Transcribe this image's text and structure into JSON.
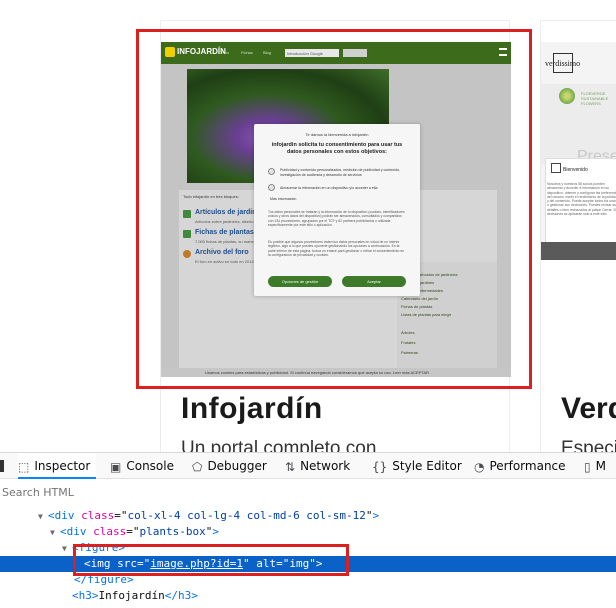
{
  "page": {
    "card1": {
      "title": "Infojardín",
      "desc": "Un portal completo con"
    },
    "card2": {
      "title": "Verd",
      "desc": "Especi"
    }
  },
  "infojardin_shot": {
    "logo": "INFOJARDÍN",
    "nav": [
      "Foro",
      "Fichas",
      "Blog"
    ],
    "search_placeholder": "Introducción Google",
    "heading": "Todo infojardín en tres bloques:",
    "links": [
      {
        "title": "Artículos de jardinería",
        "sub": "Artículos sobre jardinería, diseño..."
      },
      {
        "title": "Fichas de plantas",
        "sub": "7.000 fichas de plantas, su manejo..."
      },
      {
        "title": "Archivo del foro",
        "sub": "El foro en activo en todo en 2014..."
      }
    ],
    "sidebar": [
      "Césped",
      "Árboles y arbustos de jardinería",
      "Diseño de jardines",
      "Plagas y enfermedades",
      "Calendario del jardín",
      "Fichas de plantas",
      "Listas de plantas para elegir",
      "Árboles",
      "Frutales",
      "Palmeras"
    ],
    "footer": "Usamos cookies para estadísticas y publicidad. Si continúa navegando consideramos que acepta su uso.   Leer más      ACEPTAR",
    "modal": {
      "welcome": "Te damos la bienvenida a infojardín",
      "title": "infojardin solicita tu consentimiento para usar tus datos personales con estos objetivos:",
      "options": [
        "Publicidad y contenido personalizados, medición de publicidad y contenido, investigación de audiencia y desarrollo de servicios",
        "Almacenar la información en un dispositivo y/o acceder a ella"
      ],
      "more": "Más información",
      "body1": "Tus datos personales se tratarán y la información de tu dispositivo (cookies, identificadores únicos y otros datos del dispositivo) podrán ser almacenados, consultados y compartidos con 134 proveedores, agrupados por el TCF y 62 partners publicitarios o utilizada específicamente por este sitio o aplicación.",
      "body2": "Es posible que algunos proveedores traten tus datos personales en virtud de un interés legítimo, algo a lo que puedes oponerte gestionando tus opciones a continuación. En la parte inferior de esta página, busca un enlace para gestionar o retirar el consentimiento en la configuración de privacidad y cookies.",
      "btn_options": "Opciones de gestión",
      "btn_accept": "Aceptar"
    }
  },
  "verdissimo_shot": {
    "logo": "verdissimo",
    "brand": "FLORVERDE SUSTAINABLE FLOWERS",
    "pres": "Prese",
    "bienvenido": "Bienvenido",
    "text": "Nosotros y nuestros 58 socios pueden almacenar y acceder a información en su dispositivo, obtener y configurar las preferencias del usuario, medir el rendimiento de la publicidad y del contenido. Puede aceptar todos los socios o gestionar sus decisiones. Puedes revisar sus detalles o bien rechazarlos al pulsar Cerrar. Sus decisiones se aplicarán solo a este sitio."
  },
  "devtools": {
    "tabs": [
      {
        "label": "Inspector",
        "icon": "inspector-icon",
        "active": true
      },
      {
        "label": "Console",
        "icon": "console-icon"
      },
      {
        "label": "Debugger",
        "icon": "debugger-icon"
      },
      {
        "label": "Network",
        "icon": "network-icon"
      },
      {
        "label": "Style Editor",
        "icon": "style-editor-icon"
      },
      {
        "label": "Performance",
        "icon": "performance-icon"
      },
      {
        "label": "M",
        "icon": "memory-icon"
      }
    ],
    "search_placeholder": "Search HTML",
    "tree": {
      "l1": {
        "tag_open": "<div",
        "attr": "class",
        "val": "col-xl-4 col-lg-4 col-md-6 col-sm-12",
        "tag_close": ">"
      },
      "l2": {
        "tag_open": "<div",
        "attr": "class",
        "val": "plants-box",
        "tag_close": ">"
      },
      "l3": {
        "tag": "<figure>"
      },
      "l4": {
        "tag_open": "<img",
        "attr1": "src",
        "val1": "image.php?id=1",
        "attr2": "alt",
        "val2": "img",
        "tag_close": ">"
      },
      "l5": {
        "tag": "</figure>"
      },
      "l6": {
        "tag_open": "<h3>",
        "text": "Infojardín",
        "tag_close": "</h3>"
      }
    }
  },
  "colors": {
    "highlight": "#dc1f1f",
    "selection": "#0a62c8",
    "devtools_accent": "#0a84ff"
  }
}
